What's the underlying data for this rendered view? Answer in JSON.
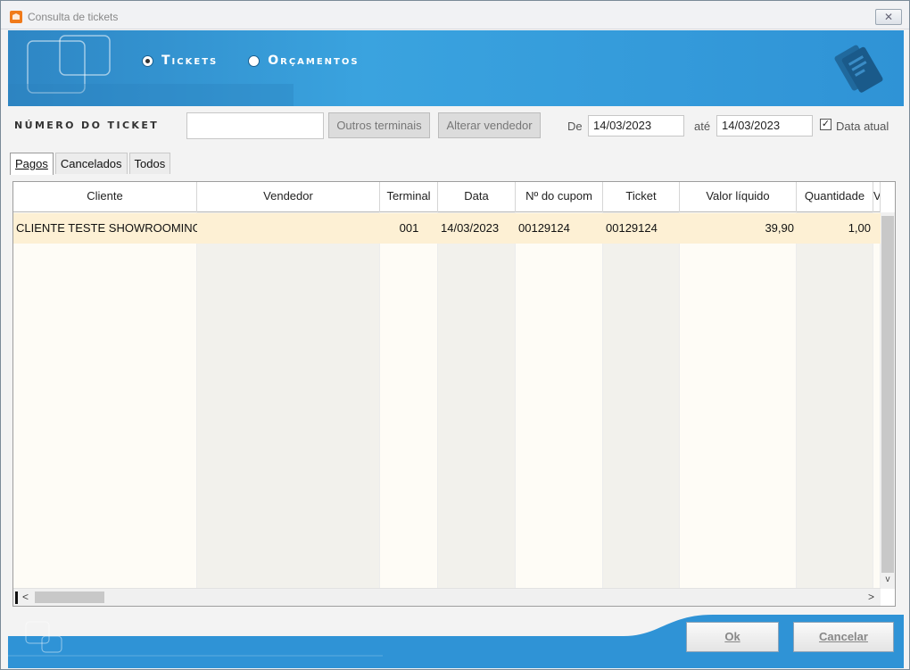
{
  "window": {
    "title": "Consulta de tickets",
    "close_glyph": "✕"
  },
  "header": {
    "radio_options": [
      {
        "label": "Tickets",
        "selected": true
      },
      {
        "label": "Orçamentos",
        "selected": false
      }
    ]
  },
  "filter": {
    "ticket_number_label": "NÚMERO DO TICKET",
    "ticket_number_value": "",
    "outros_terminais_label": "Outros terminais",
    "alterar_vendedor_label": "Alterar vendedor",
    "from_label": "De",
    "from_date": "14/03/2023",
    "to_label": "até",
    "to_date": "14/03/2023",
    "current_date_label": "Data atual",
    "current_date_checked": true,
    "check_glyph": "✓"
  },
  "tabs": [
    {
      "label": "Pagos",
      "active": true
    },
    {
      "label": "Cancelados",
      "active": false
    },
    {
      "label": "Todos",
      "active": false
    }
  ],
  "grid": {
    "columns": [
      "Cliente",
      "Vendedor",
      "Terminal",
      "Data",
      "Nº do cupom",
      "Ticket",
      "Valor líquido",
      "Quantidade",
      "V"
    ],
    "rows": [
      [
        "CLIENTE TESTE SHOWROOMING TI",
        "",
        "001",
        "14/03/2023",
        "00129124",
        "00129124",
        "39,90",
        "1,00",
        ""
      ]
    ],
    "scroll_left_glyph": "<",
    "scroll_right_glyph": ">",
    "scroll_down_glyph": "v"
  },
  "footer": {
    "ok_label": "Ok",
    "cancel_label": "Cancelar"
  },
  "colors": {
    "header_blue": "#3aa3df",
    "row_selected": "#fdf0d4",
    "footer_blue": "#2f93d6"
  }
}
